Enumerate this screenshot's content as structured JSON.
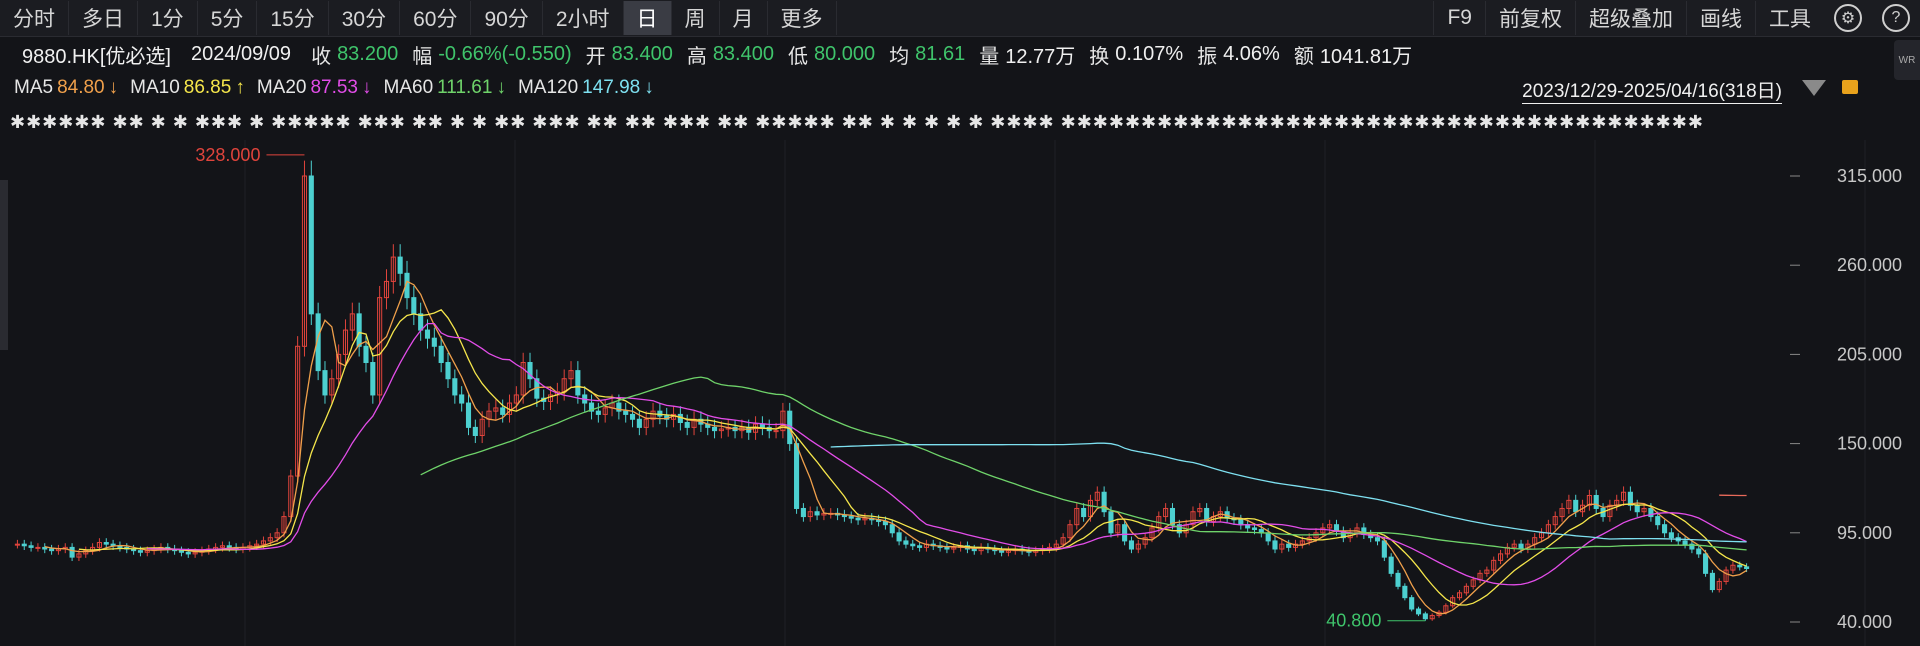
{
  "toolbar": {
    "periods": [
      "分时",
      "多日",
      "1分",
      "5分",
      "15分",
      "30分",
      "60分",
      "90分",
      "2小时",
      "日",
      "周",
      "月",
      "更多"
    ],
    "active_period": "日",
    "right_items": [
      "F9",
      "前复权",
      "超级叠加",
      "画线",
      "工具"
    ],
    "settings_icon": "gear-icon",
    "help_icon": "question-icon"
  },
  "quote": {
    "symbol": "9880.HK[优必选]",
    "date": "2024/09/09",
    "close_label": "收",
    "close": "83.200",
    "change_label": "幅",
    "change": "-0.66%(-0.550)",
    "open_label": "开",
    "open": "83.400",
    "high_label": "高",
    "high": "83.400",
    "low_label": "低",
    "low": "80.000",
    "avg_label": "均",
    "avg": "81.61",
    "volume_label": "量",
    "volume": "12.77万",
    "turnover_label": "换",
    "turnover": "0.107%",
    "amplitude_label": "振",
    "amplitude": "4.06%",
    "amount_label": "额",
    "amount": "1041.81万"
  },
  "ma_legend": [
    {
      "name": "MA5",
      "value": "84.80",
      "arrow": "↓",
      "color": "#f0a04b"
    },
    {
      "name": "MA10",
      "value": "86.85",
      "arrow": "↑",
      "color": "#f5e64b"
    },
    {
      "name": "MA20",
      "value": "87.53",
      "arrow": "↓",
      "color": "#e24de8"
    },
    {
      "name": "MA60",
      "value": "111.61",
      "arrow": "↓",
      "color": "#6fd36a"
    },
    {
      "name": "MA120",
      "value": "147.98",
      "arrow": "↓",
      "color": "#7ee0f0"
    }
  ],
  "date_range": "2023/12/29-2025/04/16(318日)",
  "event_markers": "✱✱✱✱✱✱ ✱✱   ✱   ✱        ✱✱✱ ✱    ✱✱✱✱✱    ✱✱✱    ✱✱     ✱            ✱    ✱✱     ✱✱✱ ✱✱ ✱✱    ✱✱✱ ✱✱ ✱✱✱✱✱ ✱✱  ✱ ✱ ✱       ✱ ✱ ✱✱✱✱     ✱✱✱✱✱✱✱✱✱✱✱✱✱✱✱✱✱✱✱✱✱✱✱✱✱✱✱✱✱✱✱✱✱✱✱✱✱✱✱✱",
  "chart_data": {
    "type": "candlestick",
    "y_ticks": [
      "315.000",
      "260.000",
      "205.000",
      "150.000",
      "95.000",
      "40.000"
    ],
    "ylim": [
      40,
      315
    ],
    "max_label": "328.000",
    "min_label": "40.800",
    "up_color": "#e0443c",
    "down_color": "#4dd0d0",
    "closes": [
      88,
      87,
      86,
      86,
      85,
      84,
      85,
      86,
      80,
      82,
      84,
      86,
      89,
      88,
      87,
      86,
      85,
      84,
      83,
      84,
      85,
      86,
      85,
      84,
      83,
      82,
      83,
      84,
      85,
      86,
      87,
      86,
      85,
      86,
      87,
      88,
      90,
      92,
      95,
      105,
      130,
      210,
      315,
      230,
      195,
      180,
      190,
      205,
      220,
      230,
      210,
      200,
      180,
      240,
      250,
      265,
      255,
      240,
      230,
      220,
      215,
      210,
      200,
      190,
      180,
      175,
      160,
      155,
      165,
      170,
      172,
      168,
      175,
      180,
      200,
      190,
      178,
      176,
      180,
      182,
      190,
      195,
      180,
      175,
      170,
      168,
      172,
      175,
      170,
      168,
      165,
      160,
      165,
      170,
      167,
      165,
      168,
      163,
      160,
      165,
      162,
      160,
      158,
      159,
      160,
      158,
      160,
      157,
      162,
      160,
      158,
      158,
      170,
      150,
      110,
      105,
      108,
      106,
      107,
      107,
      106,
      105,
      104,
      103,
      104,
      103,
      102,
      100,
      95,
      90,
      88,
      87,
      86,
      88,
      87,
      86,
      85,
      86,
      87,
      85,
      84,
      86,
      85,
      84,
      83,
      84,
      85,
      84,
      83,
      84,
      85,
      86,
      88,
      92,
      100,
      110,
      105,
      115,
      120,
      108,
      95,
      100,
      90,
      85,
      88,
      92,
      98,
      105,
      110,
      100,
      95,
      100,
      108,
      110,
      102,
      105,
      108,
      104,
      103,
      100,
      98,
      97,
      95,
      90,
      85,
      88,
      86,
      88,
      90,
      92,
      95,
      98,
      100,
      96,
      92,
      95,
      98,
      94,
      92,
      90,
      80,
      70,
      62,
      55,
      48,
      45,
      42,
      44,
      46,
      50,
      55,
      58,
      62,
      66,
      70,
      72,
      78,
      82,
      86,
      88,
      85,
      88,
      92,
      95,
      100,
      105,
      110,
      115,
      108,
      112,
      118,
      110,
      105,
      112,
      115,
      120,
      112,
      108,
      110,
      105,
      100,
      95,
      92,
      90,
      88,
      85,
      82,
      70,
      60,
      65,
      72,
      75,
      74,
      73
    ],
    "ma_series": [
      {
        "name": "MA5",
        "color": "#f0a04b"
      },
      {
        "name": "MA10",
        "color": "#f5e64b"
      },
      {
        "name": "MA20",
        "color": "#e24de8"
      },
      {
        "name": "MA60",
        "color": "#6fd36a"
      },
      {
        "name": "MA120",
        "color": "#7ee0f0"
      },
      {
        "name": "MA250",
        "color": "#e86a5a"
      }
    ]
  }
}
